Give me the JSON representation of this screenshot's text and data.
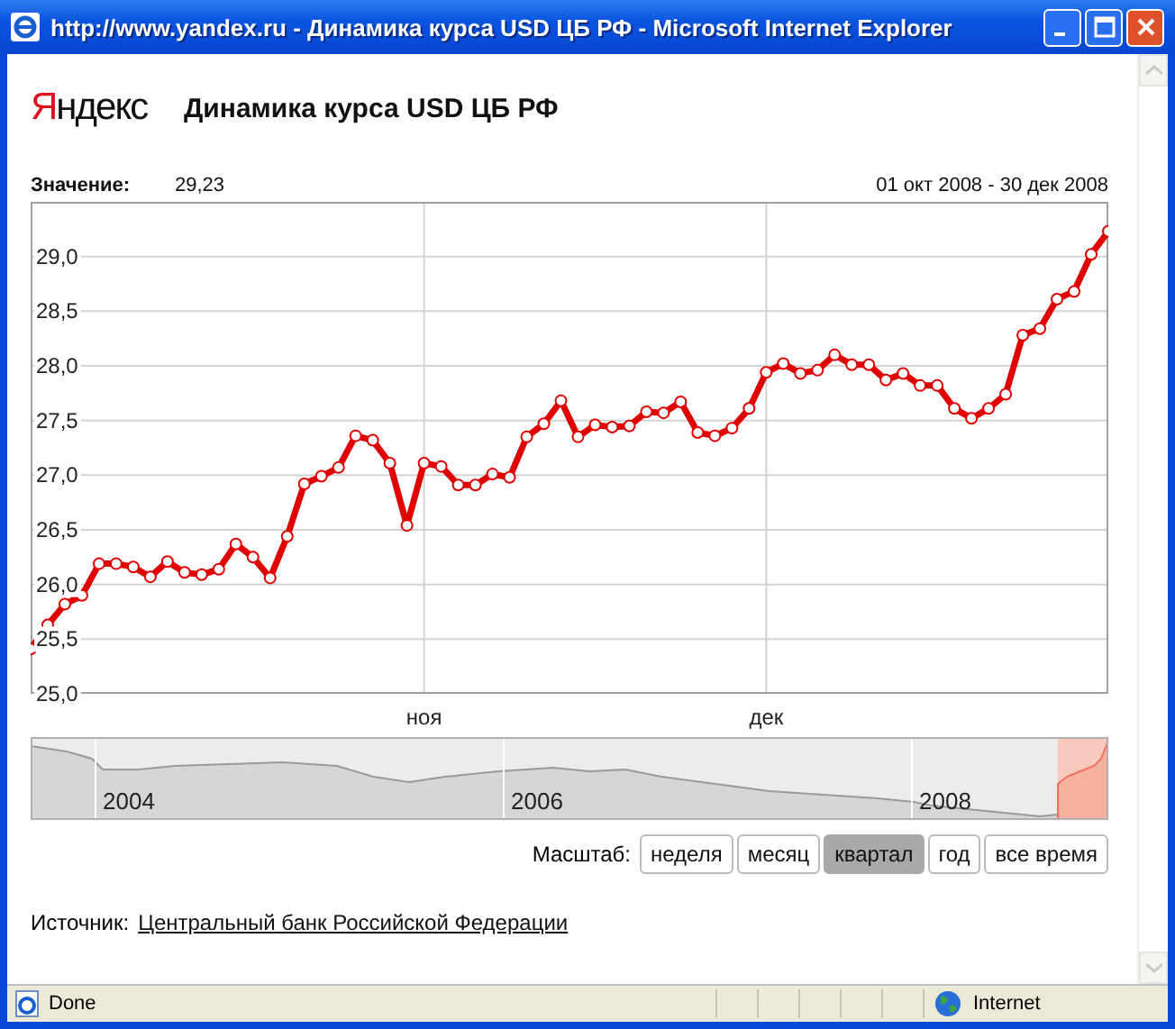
{
  "window": {
    "title": "http://www.yandex.ru - Динамика курса USD ЦБ РФ - Microsoft Internet Explorer"
  },
  "header": {
    "logo": "Яндекс",
    "title": "Динамика курса USD ЦБ РФ"
  },
  "value": {
    "label": "Значение:",
    "value": "29,23"
  },
  "period": "01 окт 2008 - 30 дек 2008",
  "chart_data": {
    "type": "line",
    "ylim": [
      25,
      29.5
    ],
    "grid": true,
    "yticks": [
      {
        "value": 25,
        "label": "25,0"
      },
      {
        "value": 25.5,
        "label": "25,5"
      },
      {
        "value": 26,
        "label": "26,0"
      },
      {
        "value": 26.5,
        "label": "26,5"
      },
      {
        "value": 27,
        "label": "27,0"
      },
      {
        "value": 27.5,
        "label": "27,5"
      },
      {
        "value": 28,
        "label": "28,0"
      },
      {
        "value": 28.5,
        "label": "28,5"
      },
      {
        "value": 29,
        "label": "29,0"
      }
    ],
    "series": [
      {
        "color": "#e00000",
        "marker": "circle",
        "values": [
          25.41,
          25.63,
          25.82,
          25.9,
          26.19,
          26.19,
          26.16,
          26.07,
          26.21,
          26.11,
          26.09,
          26.14,
          26.37,
          26.25,
          26.06,
          26.44,
          26.92,
          26.99,
          27.07,
          27.36,
          27.32,
          27.11,
          26.54,
          27.11,
          27.08,
          26.91,
          26.91,
          27.01,
          26.98,
          27.35,
          27.47,
          27.68,
          27.35,
          27.46,
          27.44,
          27.45,
          27.58,
          27.57,
          27.67,
          27.39,
          27.36,
          27.43,
          27.61,
          27.94,
          28.02,
          27.93,
          27.96,
          28.1,
          28.01,
          28.01,
          27.87,
          27.93,
          27.82,
          27.82,
          27.61,
          27.52,
          27.61,
          27.74,
          28.28,
          28.34,
          28.61,
          28.68,
          29.02,
          29.23
        ]
      }
    ]
  },
  "month_labels": [
    "ноя",
    "дек"
  ],
  "overview": {
    "years": [
      "2004",
      "2006",
      "2008"
    ]
  },
  "scale": {
    "label": "Масштаб:",
    "buttons": [
      {
        "label": "неделя",
        "selected": false
      },
      {
        "label": "месяц",
        "selected": false
      },
      {
        "label": "квартал",
        "selected": true
      },
      {
        "label": "год",
        "selected": false
      },
      {
        "label": "все время",
        "selected": false
      }
    ]
  },
  "source": {
    "label": "Источник:",
    "link": "Центральный банк Российской Федерации"
  },
  "status_bar": {
    "text": "Done",
    "zone": "Internet"
  }
}
